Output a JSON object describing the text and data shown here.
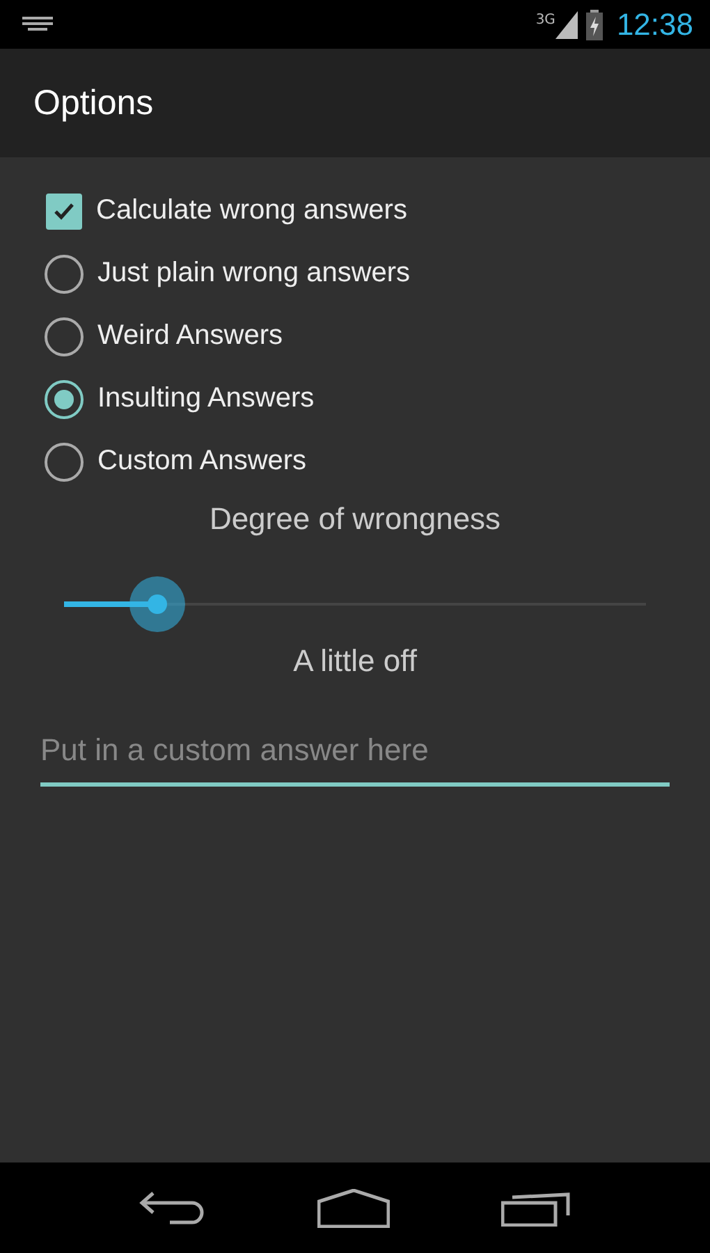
{
  "status_bar": {
    "network": "3G",
    "time": "12:38"
  },
  "action_bar": {
    "title": "Options"
  },
  "options": [
    {
      "kind": "checkbox",
      "label": "Calculate wrong answers",
      "checked": true
    },
    {
      "kind": "radio",
      "label": "Just plain wrong answers",
      "selected": false
    },
    {
      "kind": "radio",
      "label": "Weird Answers",
      "selected": false
    },
    {
      "kind": "radio",
      "label": "Insulting Answers",
      "selected": true
    },
    {
      "kind": "radio",
      "label": "Custom Answers",
      "selected": false
    }
  ],
  "slider": {
    "title": "Degree of wrongness",
    "level": 0.16,
    "reading": "A little off"
  },
  "custom_answer": {
    "placeholder": "Put in a custom answer here"
  }
}
